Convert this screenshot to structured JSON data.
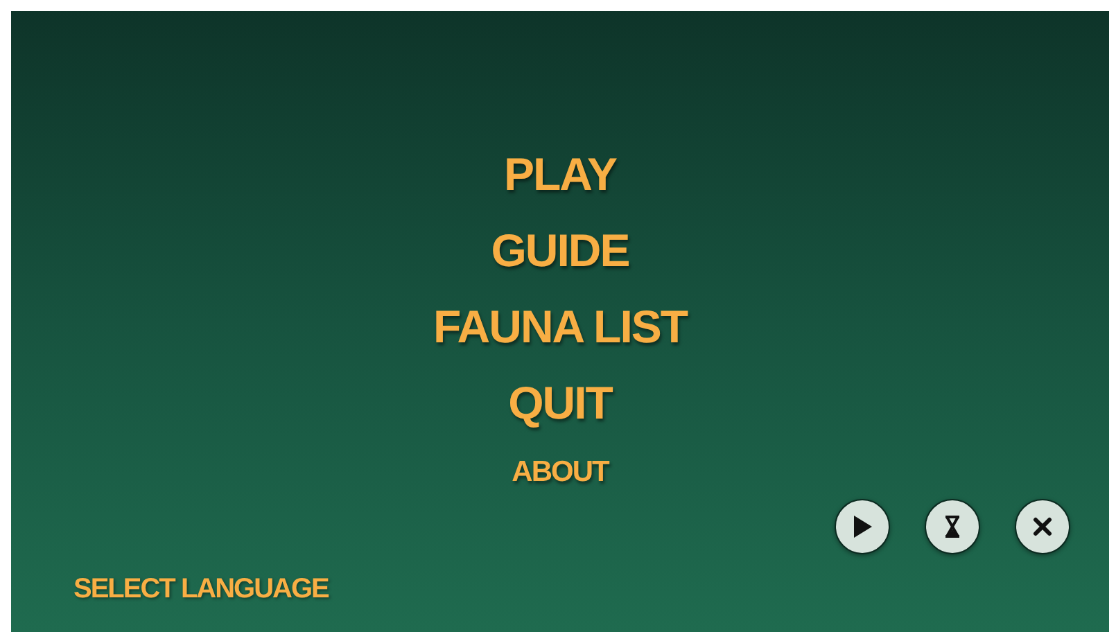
{
  "menu": [
    {
      "label": "PLAY",
      "kind": "main"
    },
    {
      "label": "GUIDE",
      "kind": "main"
    },
    {
      "label": "FAUNA LIST",
      "kind": "main"
    },
    {
      "label": "QUIT",
      "kind": "main"
    },
    {
      "label": "ABOUT",
      "kind": "minor"
    }
  ],
  "icon_buttons": [
    {
      "kind": "play"
    },
    {
      "kind": "hourglass"
    },
    {
      "kind": "close"
    }
  ],
  "language_link": "SELECT LANGUAGE"
}
